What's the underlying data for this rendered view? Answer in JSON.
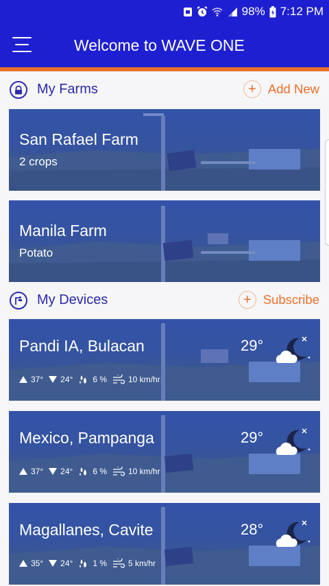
{
  "status_bar": {
    "battery_percent": "98%",
    "time": "7:12 PM",
    "icons": [
      "notification-icon",
      "alarm-icon",
      "wifi-icon",
      "signal-icon",
      "battery-icon"
    ]
  },
  "app_bar": {
    "title": "Welcome to WAVE ONE",
    "menu_icon": "hamburger-menu-icon"
  },
  "colors": {
    "primary": "#1f1fd2",
    "accent": "#e8702a",
    "section_text": "#2b2aa8"
  },
  "farms_section": {
    "title": "My Farms",
    "action_label": "Add New",
    "icon": "farm-lock-icon",
    "farms": [
      {
        "name": "San Rafael Farm",
        "detail": "2 crops"
      },
      {
        "name": "Manila Farm",
        "detail": "Potato"
      }
    ]
  },
  "devices_section": {
    "title": "My Devices",
    "action_label": "Subscribe",
    "icon": "weather-station-icon",
    "devices": [
      {
        "name": "Pandi IA, Bulacan",
        "temp": "29°",
        "high": "37°",
        "low": "24°",
        "humidity": "6 %",
        "wind": "10 km/hr",
        "condition_icon": "cloudy-night-icon"
      },
      {
        "name": "Mexico, Pampanga",
        "temp": "29°",
        "high": "37°",
        "low": "24°",
        "humidity": "6 %",
        "wind": "10 km/hr",
        "condition_icon": "cloudy-night-icon"
      },
      {
        "name": "Magallanes, Cavite",
        "temp": "28°",
        "high": "35°",
        "low": "24°",
        "humidity": "1 %",
        "wind": "5 km/hr",
        "condition_icon": "cloudy-night-icon"
      }
    ]
  }
}
